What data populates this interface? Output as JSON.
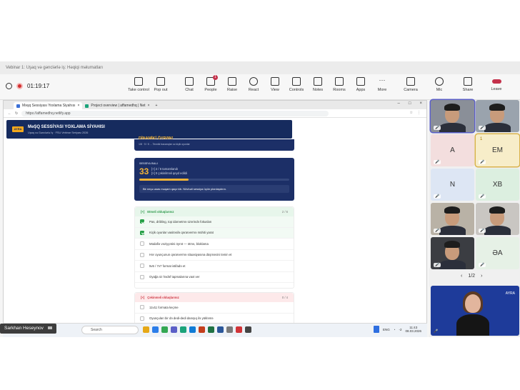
{
  "meeting": {
    "title": "Vebinar 1: Uşaq və gənclərlə iş: Həqiqi məlumatları",
    "timer": "01:19:17",
    "toolbar": [
      {
        "label": "Take control",
        "icon": "take-control-icon"
      },
      {
        "label": "Pop out",
        "icon": "pop-out-icon"
      },
      {
        "label": "Chat",
        "icon": "chat-icon"
      },
      {
        "label": "People",
        "icon": "people-icon",
        "badge": "1"
      },
      {
        "label": "Raise",
        "icon": "raise-hand-icon"
      },
      {
        "label": "React",
        "icon": "react-icon"
      },
      {
        "label": "View",
        "icon": "view-icon"
      },
      {
        "label": "Controls",
        "icon": "controls-icon"
      },
      {
        "label": "Notes",
        "icon": "notes-icon"
      },
      {
        "label": "Rooms",
        "icon": "rooms-icon"
      },
      {
        "label": "Apps",
        "icon": "apps-icon"
      },
      {
        "label": "More",
        "icon": "more-icon"
      },
      {
        "label": "Camera",
        "icon": "camera-icon"
      },
      {
        "label": "Mic",
        "icon": "mic-icon"
      },
      {
        "label": "Share",
        "icon": "share-icon"
      },
      {
        "label": "Leave",
        "icon": "leave-icon"
      }
    ],
    "presenter": "Sarkhan Heseynov",
    "pager": "1/2",
    "participants": [
      {
        "initials": "",
        "type": "photo"
      },
      {
        "initials": "",
        "type": "photo"
      },
      {
        "initials": "A",
        "type": "initials"
      },
      {
        "initials": "EM",
        "type": "initials",
        "badge": "1"
      },
      {
        "initials": "N",
        "type": "initials"
      },
      {
        "initials": "XB",
        "type": "initials"
      },
      {
        "initials": "",
        "type": "photo"
      },
      {
        "initials": "",
        "type": "photo"
      },
      {
        "initials": "",
        "type": "photo"
      },
      {
        "initials": "ƏA",
        "type": "initials"
      }
    ],
    "big_tile_logo": "AYRA"
  },
  "browser": {
    "tabs": [
      {
        "title": "Məşq Sessiyası Yoxlama Siyahısı"
      },
      {
        "title": "Project overview | affamedhq | Net"
      }
    ],
    "url": "https://affamedhq.netlify.app"
  },
  "app": {
    "logo": "AYRA",
    "title": "MəŞQ SESSİYASI YOXLAMA SİYAHISI",
    "subtitle": "Uşaq və Gənclərlə İş · FSU Vebinar Seriyası 2026",
    "top_card": {
      "title": "DİNAMİKİ ÖYRƏN!",
      "sub": "1/8 · 5 / 5 ... Texniki bacarıqlar və kiçik oyunlar"
    },
    "score": {
      "label": "SESSİYA BALI",
      "value": "33",
      "line1": "[+] 2 / 6 tamamlandı",
      "line2": "[×] 0 çəkinilməli qeyd edildi",
      "progress": 0.33,
      "message": "Bir neçə əsas məqam qaçırılıb. Növbəti sessiya üçün planlaşdırın."
    },
    "should_do": {
      "mark": "[+]",
      "title": "Etməli olduqlarınız",
      "count": "2 / 6",
      "items": [
        {
          "text": "Pas, dribling, top idarəetmə üzərində fokuslan",
          "done": true
        },
        {
          "text": "Kiçik oyunlar vasitəsilə qərarvermə mühiti yarat",
          "done": true
        },
        {
          "text": "Müdafiə vəziyyətini öyrət — ötmə, bloklama",
          "done": false
        },
        {
          "text": "Hər oyunçunun qərarvermə situasiyasına düşməsini təmin et",
          "done": false
        },
        {
          "text": "5v5 / 7v7 format istifadə et",
          "done": false
        },
        {
          "text": "Oyağa öz hədəf tapmalarına vaxt ver",
          "done": false
        }
      ]
    },
    "avoid": {
      "mark": "[×]",
      "title": "Çəkinməli olduqlarınız",
      "count": "0 / 4",
      "items": [
        {
          "text": "11v11 formata keçme",
          "done": false
        },
        {
          "text": "Oyunçuları bir də dedi-dedi danışıq ilə yükləmə",
          "done": false
        }
      ]
    }
  },
  "taskbar": {
    "search": "Search",
    "lang": "ENG",
    "time": "11:43",
    "date": "08.03.2026",
    "temp": "-2"
  },
  "colors": {
    "navy": "#1c2f67",
    "gold": "#f2b337",
    "green": "#27a047",
    "red": "#cf3945",
    "teams_purple": "#5b5fc7"
  }
}
